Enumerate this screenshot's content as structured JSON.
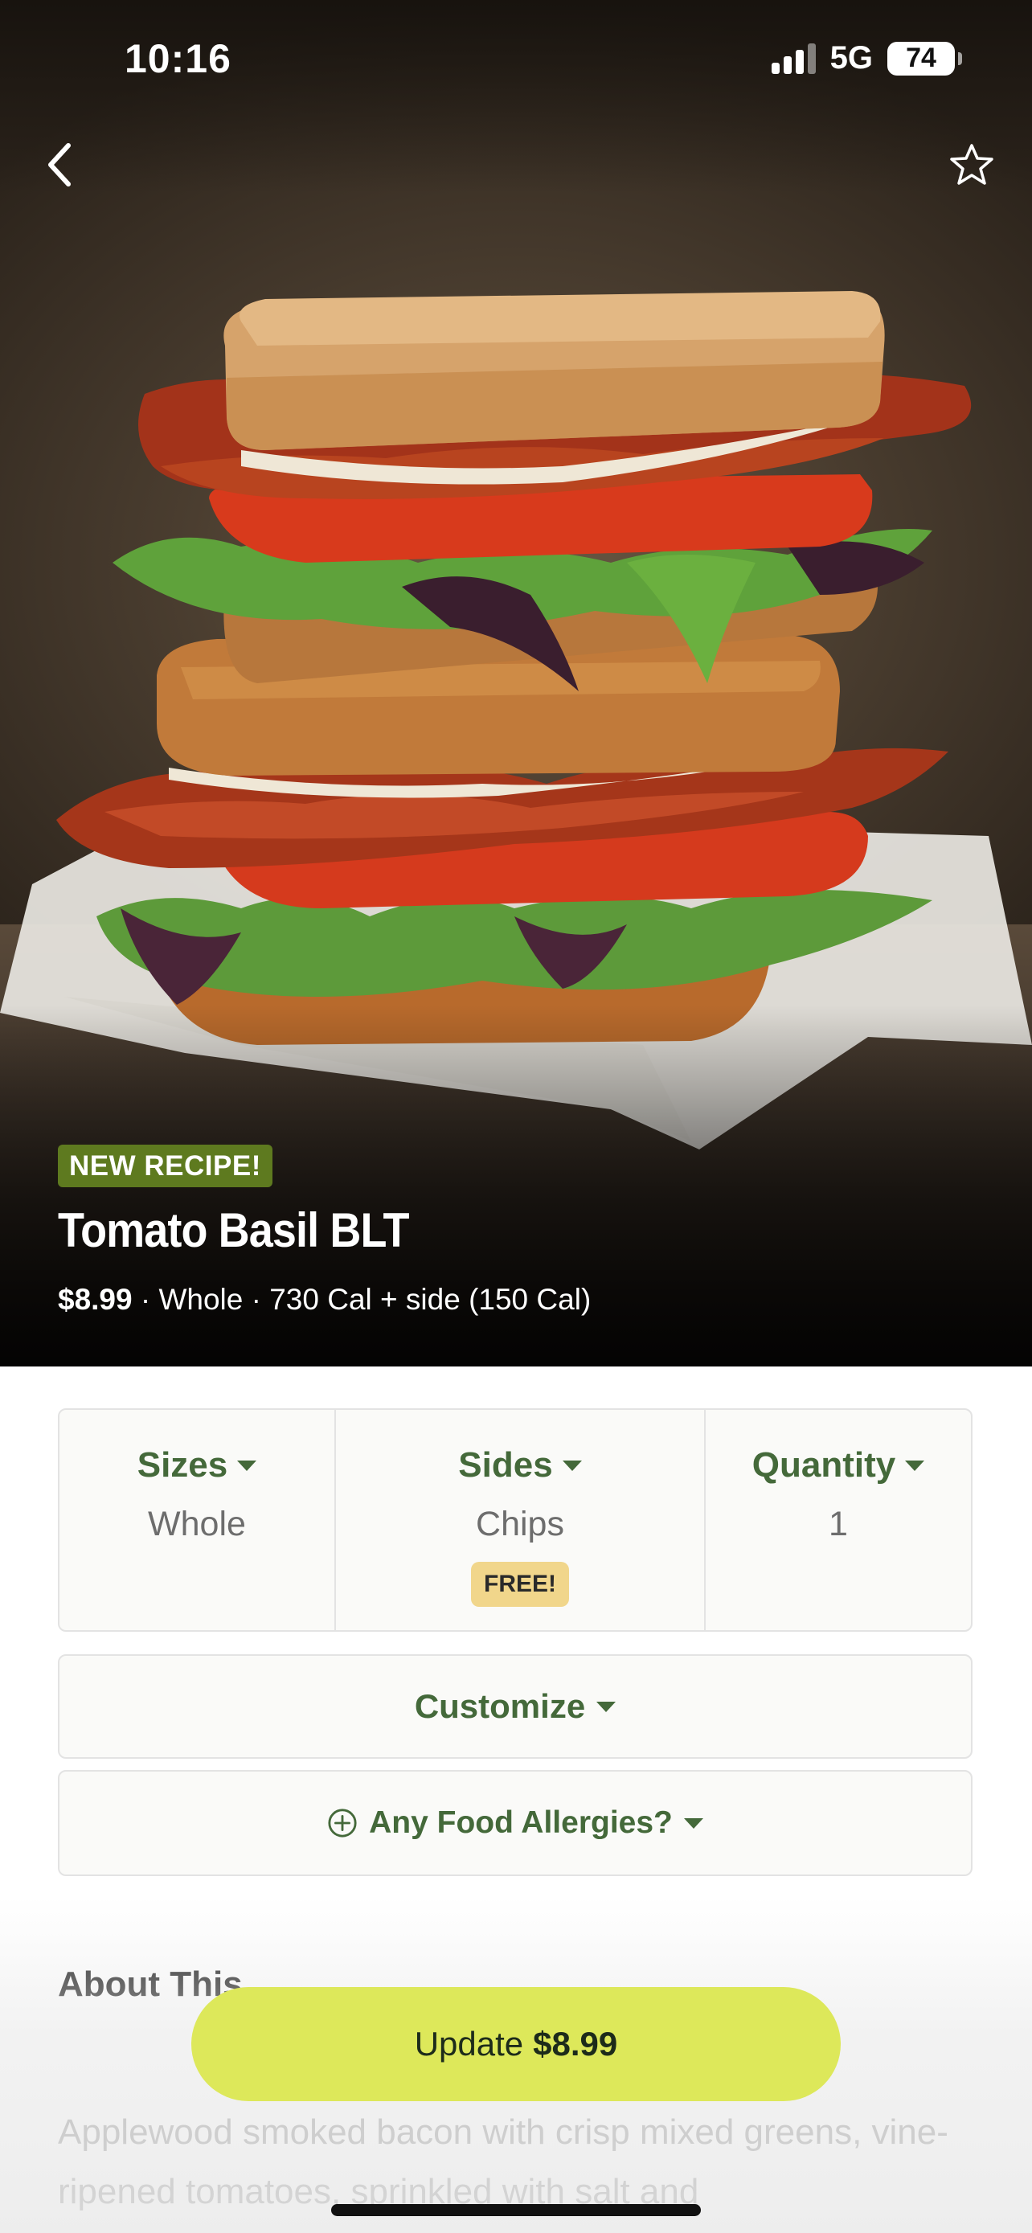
{
  "status_bar": {
    "time": "10:16",
    "network": "5G",
    "battery": "74"
  },
  "header": {
    "back_icon": "chevron-left-icon",
    "favorite_icon": "star-outline-icon"
  },
  "hero": {
    "badge": "NEW RECIPE!",
    "title": "Tomato Basil BLT",
    "price": "$8.99",
    "details": "· Whole · 730 Cal + side (150 Cal)"
  },
  "options": {
    "sizes": {
      "label": "Sizes",
      "value": "Whole"
    },
    "sides": {
      "label": "Sides",
      "value": "Chips",
      "badge": "FREE!"
    },
    "quantity": {
      "label": "Quantity",
      "value": "1"
    }
  },
  "customize": {
    "label": "Customize"
  },
  "allergies": {
    "label": "Any Food Allergies?"
  },
  "about": {
    "title": "About This",
    "text": "Applewood smoked bacon with crisp mixed greens, vine-ripened tomatoes, sprinkled with salt and"
  },
  "cta": {
    "label": "Update",
    "price": "$8.99"
  },
  "colors": {
    "accent_green": "#44693a",
    "badge_green": "#5e7a1f",
    "cta_yellow": "#dde85a",
    "free_badge": "#f1d68b"
  }
}
